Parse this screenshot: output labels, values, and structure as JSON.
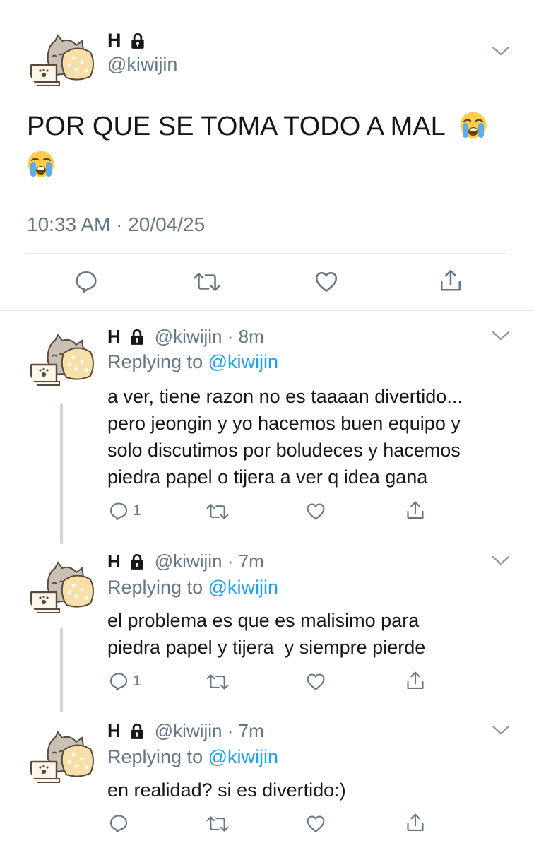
{
  "main_tweet": {
    "name": "H",
    "handle": "@kiwijin",
    "text": "POR QUE SE TOMA TODO A MAL",
    "timestamp": "10:33 AM · 20/04/25"
  },
  "replies": [
    {
      "name": "H",
      "handle_time": "@kiwijin · 8m",
      "replying_prefix": "Replying to",
      "replying_handle": "@kiwijin",
      "lines": [
        "a ver, tiene razon no es taaaan divertido...",
        "pero jeongin y yo hacemos buen equipo y",
        "solo discutimos por boludeces y hacemos",
        "piedra papel o tijera a ver q idea gana"
      ],
      "reply_count": "1"
    },
    {
      "name": "H",
      "handle_time": "@kiwijin · 7m",
      "replying_prefix": "Replying to",
      "replying_handle": "@kiwijin",
      "lines": [
        "el problema es que es malisimo para",
        "piedra papel y tijera  y siempre pierde"
      ],
      "reply_count": "1"
    },
    {
      "name": "H",
      "handle_time": "@kiwijin · 7m",
      "replying_prefix": "Replying to",
      "replying_handle": "@kiwijin",
      "lines": [
        "en realidad? si es divertido:)"
      ],
      "reply_count": ""
    }
  ],
  "icons": {
    "reply": "speech-bubble-icon",
    "retweet": "retweet-arrows-icon",
    "like": "heart-icon",
    "share": "share-upload-icon",
    "lock": "lock-icon",
    "menu": "chevron-down-icon",
    "emoji": "loudly-crying-face-emoji"
  },
  "colors": {
    "text": "#14171a",
    "secondary": "#657786",
    "link": "#1da1f2",
    "divider": "#e1e8ed",
    "thread_line": "#ccd6dd"
  }
}
